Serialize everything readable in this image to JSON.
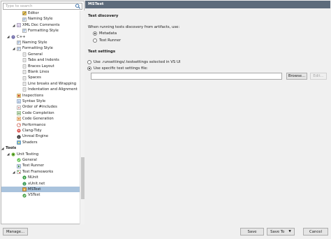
{
  "search": {
    "placeholder": "Type to search"
  },
  "tree": [
    {
      "label": "Editor",
      "indent": 2,
      "icon": "editor"
    },
    {
      "label": "Naming Style",
      "indent": 2,
      "icon": "style"
    },
    {
      "label": "XML Doc Comments",
      "indent": 1,
      "icon": "xml",
      "expanded": true
    },
    {
      "label": "Formatting Style",
      "indent": 2,
      "icon": "style"
    },
    {
      "label": "C++",
      "indent": 0,
      "icon": "cpp",
      "expanded": true
    },
    {
      "label": "Naming Style",
      "indent": 1,
      "icon": "style"
    },
    {
      "label": "Formatting Style",
      "indent": 1,
      "icon": "style",
      "expanded": true
    },
    {
      "label": "General",
      "indent": 2,
      "icon": "page"
    },
    {
      "label": "Tabs and Indents",
      "indent": 2,
      "icon": "page"
    },
    {
      "label": "Braces Layout",
      "indent": 2,
      "icon": "page"
    },
    {
      "label": "Blank Lines",
      "indent": 2,
      "icon": "page"
    },
    {
      "label": "Spaces",
      "indent": 2,
      "icon": "page"
    },
    {
      "label": "Line breaks and Wrapping",
      "indent": 2,
      "icon": "page"
    },
    {
      "label": "Indentation and Alignment",
      "indent": 2,
      "icon": "page"
    },
    {
      "label": "Inspections",
      "indent": 1,
      "icon": "inspect"
    },
    {
      "label": "Syntax Style",
      "indent": 1,
      "icon": "syntax"
    },
    {
      "label": "Order of #includes",
      "indent": 1,
      "icon": "order"
    },
    {
      "label": "Code Completion",
      "indent": 1,
      "icon": "completion"
    },
    {
      "label": "Code Generation",
      "indent": 1,
      "icon": "generation"
    },
    {
      "label": "Performance",
      "indent": 1,
      "icon": "perf"
    },
    {
      "label": "Clang-Tidy",
      "indent": 1,
      "icon": "clang"
    },
    {
      "label": "Unreal Engine",
      "indent": 1,
      "icon": "unreal"
    },
    {
      "label": "Shaders",
      "indent": 1,
      "icon": "shaders"
    },
    {
      "label": "Tools",
      "indent": -1,
      "icon": "none",
      "expanded": true,
      "bold": true
    },
    {
      "label": "Unit Testing",
      "indent": 0,
      "icon": "unittest",
      "expanded": true
    },
    {
      "label": "General",
      "indent": 1,
      "icon": "general"
    },
    {
      "label": "Test Runner",
      "indent": 1,
      "icon": "runner"
    },
    {
      "label": "Test Frameworks",
      "indent": 1,
      "icon": "frameworks",
      "expanded": true
    },
    {
      "label": "NUnit",
      "indent": 2,
      "icon": "nunit"
    },
    {
      "label": "xUnit.net",
      "indent": 2,
      "icon": "xunit"
    },
    {
      "label": "MSTest",
      "indent": 2,
      "icon": "mstest",
      "selected": true
    },
    {
      "label": "VSTest",
      "indent": 2,
      "icon": "vstest"
    }
  ],
  "panel": {
    "title": "MSTest",
    "discovery": {
      "title": "Test discovery",
      "prompt": "When running tests discovery from artifacts, use:",
      "options": [
        {
          "label": "Metadata",
          "checked": true
        },
        {
          "label": "Test Runner",
          "checked": false
        }
      ]
    },
    "settings": {
      "title": "Test settings",
      "options": [
        {
          "label": "Use .runsettings/.testsettings selected in VS UI",
          "checked": false
        },
        {
          "label": "Use specific test settings file:",
          "checked": true
        }
      ],
      "file_value": "",
      "browse_label": "Browse...",
      "edit_label": "Edit..."
    }
  },
  "footer": {
    "manage_label": "Manage...",
    "save_label": "Save",
    "save_to_label": "Save To",
    "save_to_caret": "▼",
    "cancel_label": "Cancel"
  },
  "colors": {
    "header_bg": "#5d6b7b",
    "selection_bg": "#a9c3dd"
  }
}
